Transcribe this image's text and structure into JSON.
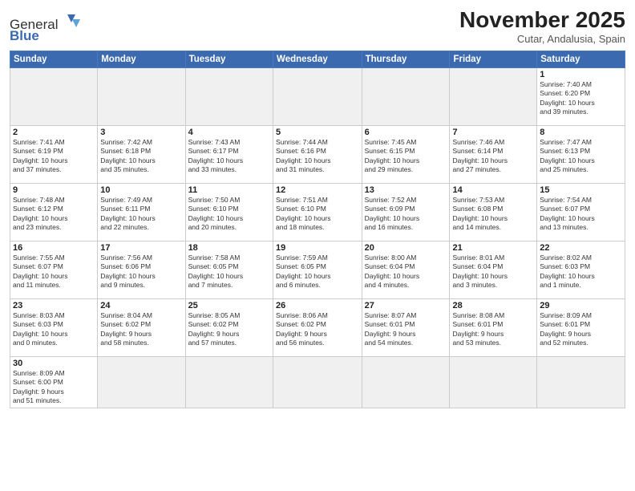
{
  "header": {
    "logo_general": "General",
    "logo_blue": "Blue",
    "month_title": "November 2025",
    "location": "Cutar, Andalusia, Spain"
  },
  "weekdays": [
    "Sunday",
    "Monday",
    "Tuesday",
    "Wednesday",
    "Thursday",
    "Friday",
    "Saturday"
  ],
  "weeks": [
    [
      {
        "day": "",
        "info": "",
        "empty": true
      },
      {
        "day": "",
        "info": "",
        "empty": true
      },
      {
        "day": "",
        "info": "",
        "empty": true
      },
      {
        "day": "",
        "info": "",
        "empty": true
      },
      {
        "day": "",
        "info": "",
        "empty": true
      },
      {
        "day": "",
        "info": "",
        "empty": true
      },
      {
        "day": "1",
        "info": "Sunrise: 7:40 AM\nSunset: 6:20 PM\nDaylight: 10 hours\nand 39 minutes."
      }
    ],
    [
      {
        "day": "2",
        "info": "Sunrise: 7:41 AM\nSunset: 6:19 PM\nDaylight: 10 hours\nand 37 minutes."
      },
      {
        "day": "3",
        "info": "Sunrise: 7:42 AM\nSunset: 6:18 PM\nDaylight: 10 hours\nand 35 minutes."
      },
      {
        "day": "4",
        "info": "Sunrise: 7:43 AM\nSunset: 6:17 PM\nDaylight: 10 hours\nand 33 minutes."
      },
      {
        "day": "5",
        "info": "Sunrise: 7:44 AM\nSunset: 6:16 PM\nDaylight: 10 hours\nand 31 minutes."
      },
      {
        "day": "6",
        "info": "Sunrise: 7:45 AM\nSunset: 6:15 PM\nDaylight: 10 hours\nand 29 minutes."
      },
      {
        "day": "7",
        "info": "Sunrise: 7:46 AM\nSunset: 6:14 PM\nDaylight: 10 hours\nand 27 minutes."
      },
      {
        "day": "8",
        "info": "Sunrise: 7:47 AM\nSunset: 6:13 PM\nDaylight: 10 hours\nand 25 minutes."
      }
    ],
    [
      {
        "day": "9",
        "info": "Sunrise: 7:48 AM\nSunset: 6:12 PM\nDaylight: 10 hours\nand 23 minutes."
      },
      {
        "day": "10",
        "info": "Sunrise: 7:49 AM\nSunset: 6:11 PM\nDaylight: 10 hours\nand 22 minutes."
      },
      {
        "day": "11",
        "info": "Sunrise: 7:50 AM\nSunset: 6:10 PM\nDaylight: 10 hours\nand 20 minutes."
      },
      {
        "day": "12",
        "info": "Sunrise: 7:51 AM\nSunset: 6:10 PM\nDaylight: 10 hours\nand 18 minutes."
      },
      {
        "day": "13",
        "info": "Sunrise: 7:52 AM\nSunset: 6:09 PM\nDaylight: 10 hours\nand 16 minutes."
      },
      {
        "day": "14",
        "info": "Sunrise: 7:53 AM\nSunset: 6:08 PM\nDaylight: 10 hours\nand 14 minutes."
      },
      {
        "day": "15",
        "info": "Sunrise: 7:54 AM\nSunset: 6:07 PM\nDaylight: 10 hours\nand 13 minutes."
      }
    ],
    [
      {
        "day": "16",
        "info": "Sunrise: 7:55 AM\nSunset: 6:07 PM\nDaylight: 10 hours\nand 11 minutes."
      },
      {
        "day": "17",
        "info": "Sunrise: 7:56 AM\nSunset: 6:06 PM\nDaylight: 10 hours\nand 9 minutes."
      },
      {
        "day": "18",
        "info": "Sunrise: 7:58 AM\nSunset: 6:05 PM\nDaylight: 10 hours\nand 7 minutes."
      },
      {
        "day": "19",
        "info": "Sunrise: 7:59 AM\nSunset: 6:05 PM\nDaylight: 10 hours\nand 6 minutes."
      },
      {
        "day": "20",
        "info": "Sunrise: 8:00 AM\nSunset: 6:04 PM\nDaylight: 10 hours\nand 4 minutes."
      },
      {
        "day": "21",
        "info": "Sunrise: 8:01 AM\nSunset: 6:04 PM\nDaylight: 10 hours\nand 3 minutes."
      },
      {
        "day": "22",
        "info": "Sunrise: 8:02 AM\nSunset: 6:03 PM\nDaylight: 10 hours\nand 1 minute."
      }
    ],
    [
      {
        "day": "23",
        "info": "Sunrise: 8:03 AM\nSunset: 6:03 PM\nDaylight: 10 hours\nand 0 minutes."
      },
      {
        "day": "24",
        "info": "Sunrise: 8:04 AM\nSunset: 6:02 PM\nDaylight: 9 hours\nand 58 minutes."
      },
      {
        "day": "25",
        "info": "Sunrise: 8:05 AM\nSunset: 6:02 PM\nDaylight: 9 hours\nand 57 minutes."
      },
      {
        "day": "26",
        "info": "Sunrise: 8:06 AM\nSunset: 6:02 PM\nDaylight: 9 hours\nand 56 minutes."
      },
      {
        "day": "27",
        "info": "Sunrise: 8:07 AM\nSunset: 6:01 PM\nDaylight: 9 hours\nand 54 minutes."
      },
      {
        "day": "28",
        "info": "Sunrise: 8:08 AM\nSunset: 6:01 PM\nDaylight: 9 hours\nand 53 minutes."
      },
      {
        "day": "29",
        "info": "Sunrise: 8:09 AM\nSunset: 6:01 PM\nDaylight: 9 hours\nand 52 minutes."
      }
    ],
    [
      {
        "day": "30",
        "info": "Sunrise: 8:09 AM\nSunset: 6:00 PM\nDaylight: 9 hours\nand 51 minutes."
      },
      {
        "day": "",
        "info": "",
        "empty": true
      },
      {
        "day": "",
        "info": "",
        "empty": true
      },
      {
        "day": "",
        "info": "",
        "empty": true
      },
      {
        "day": "",
        "info": "",
        "empty": true
      },
      {
        "day": "",
        "info": "",
        "empty": true
      },
      {
        "day": "",
        "info": "",
        "empty": true
      }
    ]
  ]
}
